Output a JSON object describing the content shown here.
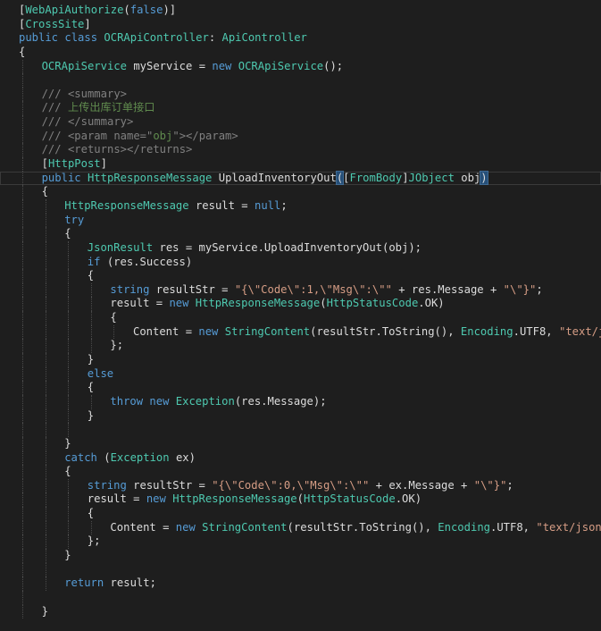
{
  "editor": {
    "lines": [
      {
        "indent": 0,
        "guides": [],
        "tokens": [
          [
            "bracket-attr",
            "["
          ],
          [
            "attr",
            "WebApiAuthorize"
          ],
          [
            "bracket-attr",
            "("
          ],
          [
            "kw",
            "false"
          ],
          [
            "bracket-attr",
            ")]"
          ]
        ]
      },
      {
        "indent": 0,
        "guides": [],
        "tokens": [
          [
            "bracket-attr",
            "["
          ],
          [
            "attr",
            "CrossSite"
          ],
          [
            "bracket-attr",
            "]"
          ]
        ]
      },
      {
        "indent": 0,
        "guides": [],
        "tokens": [
          [
            "kw",
            "public"
          ],
          [
            "ident",
            " "
          ],
          [
            "kw",
            "class"
          ],
          [
            "ident",
            " "
          ],
          [
            "type",
            "OCRApiController"
          ],
          [
            "ident",
            ": "
          ],
          [
            "type",
            "ApiController"
          ]
        ]
      },
      {
        "indent": 0,
        "guides": [],
        "tokens": [
          [
            "ident",
            "{"
          ]
        ]
      },
      {
        "indent": 1,
        "guides": [
          1
        ],
        "tokens": [
          [
            "type",
            "OCRApiService"
          ],
          [
            "ident",
            " myService = "
          ],
          [
            "kw",
            "new"
          ],
          [
            "ident",
            " "
          ],
          [
            "type",
            "OCRApiService"
          ],
          [
            "ident",
            "();"
          ]
        ]
      },
      {
        "indent": 0,
        "guides": [
          1
        ],
        "tokens": []
      },
      {
        "indent": 1,
        "guides": [
          1
        ],
        "tokens": [
          [
            "doctag",
            "///"
          ],
          [
            "doc",
            " "
          ],
          [
            "doctag",
            "<summary>"
          ]
        ]
      },
      {
        "indent": 1,
        "guides": [
          1
        ],
        "tokens": [
          [
            "doctag",
            "///"
          ],
          [
            "doc",
            " 上传出库订单接口"
          ]
        ]
      },
      {
        "indent": 1,
        "guides": [
          1
        ],
        "tokens": [
          [
            "doctag",
            "///"
          ],
          [
            "doc",
            " "
          ],
          [
            "doctag",
            "</summary>"
          ]
        ]
      },
      {
        "indent": 1,
        "guides": [
          1
        ],
        "tokens": [
          [
            "doctag",
            "///"
          ],
          [
            "doc",
            " "
          ],
          [
            "doctag",
            "<param name=\""
          ],
          [
            "doc",
            "obj"
          ],
          [
            "doctag",
            "\"></param>"
          ]
        ]
      },
      {
        "indent": 1,
        "guides": [
          1
        ],
        "tokens": [
          [
            "doctag",
            "///"
          ],
          [
            "doc",
            " "
          ],
          [
            "doctag",
            "<returns></returns>"
          ]
        ]
      },
      {
        "indent": 1,
        "guides": [
          1
        ],
        "tokens": [
          [
            "bracket-attr",
            "["
          ],
          [
            "attr",
            "HttpPost"
          ],
          [
            "bracket-attr",
            "]"
          ]
        ]
      },
      {
        "indent": 1,
        "guides": [
          1
        ],
        "current": true,
        "tokens": [
          [
            "kw",
            "public"
          ],
          [
            "ident",
            " "
          ],
          [
            "type",
            "HttpResponseMessage"
          ],
          [
            "ident",
            " "
          ],
          [
            "method",
            "UploadInventoryOut"
          ],
          [
            "paren",
            "("
          ],
          [
            "bracket-attr",
            "["
          ],
          [
            "attr",
            "FromBody"
          ],
          [
            "bracket-attr",
            "]"
          ],
          [
            "type",
            "JObject"
          ],
          [
            "ident",
            " obj"
          ],
          [
            "paren",
            ")"
          ]
        ]
      },
      {
        "indent": 1,
        "guides": [
          1
        ],
        "tokens": [
          [
            "ident",
            "{"
          ]
        ]
      },
      {
        "indent": 2,
        "guides": [
          1,
          2
        ],
        "tokens": [
          [
            "type",
            "HttpResponseMessage"
          ],
          [
            "ident",
            " result = "
          ],
          [
            "kw",
            "null"
          ],
          [
            "ident",
            ";"
          ]
        ]
      },
      {
        "indent": 2,
        "guides": [
          1,
          2
        ],
        "tokens": [
          [
            "kw",
            "try"
          ]
        ]
      },
      {
        "indent": 2,
        "guides": [
          1,
          2
        ],
        "tokens": [
          [
            "ident",
            "{"
          ]
        ]
      },
      {
        "indent": 3,
        "guides": [
          1,
          2,
          3
        ],
        "tokens": [
          [
            "type",
            "JsonResult"
          ],
          [
            "ident",
            " res = myService."
          ],
          [
            "method",
            "UploadInventoryOut"
          ],
          [
            "ident",
            "(obj);"
          ]
        ]
      },
      {
        "indent": 3,
        "guides": [
          1,
          2,
          3
        ],
        "tokens": [
          [
            "kw",
            "if"
          ],
          [
            "ident",
            " (res.Success)"
          ]
        ]
      },
      {
        "indent": 3,
        "guides": [
          1,
          2,
          3
        ],
        "tokens": [
          [
            "ident",
            "{"
          ]
        ]
      },
      {
        "indent": 4,
        "guides": [
          1,
          2,
          3,
          4
        ],
        "tokens": [
          [
            "kw",
            "string"
          ],
          [
            "ident",
            " resultStr = "
          ],
          [
            "str",
            "\"{\\\"Code\\\":1,\\\"Msg\\\":\\\"\""
          ],
          [
            "ident",
            " + res.Message + "
          ],
          [
            "str",
            "\"\\\"}\""
          ],
          [
            "ident",
            ";"
          ]
        ]
      },
      {
        "indent": 4,
        "guides": [
          1,
          2,
          3,
          4
        ],
        "tokens": [
          [
            "ident",
            "result = "
          ],
          [
            "kw",
            "new"
          ],
          [
            "ident",
            " "
          ],
          [
            "type",
            "HttpResponseMessage"
          ],
          [
            "ident",
            "("
          ],
          [
            "type",
            "HttpStatusCode"
          ],
          [
            "ident",
            ".OK)"
          ]
        ]
      },
      {
        "indent": 4,
        "guides": [
          1,
          2,
          3,
          4
        ],
        "tokens": [
          [
            "ident",
            "{"
          ]
        ]
      },
      {
        "indent": 5,
        "guides": [
          1,
          2,
          3,
          4,
          5
        ],
        "tokens": [
          [
            "ident",
            "Content = "
          ],
          [
            "kw",
            "new"
          ],
          [
            "ident",
            " "
          ],
          [
            "type",
            "StringContent"
          ],
          [
            "ident",
            "(resultStr."
          ],
          [
            "method",
            "ToString"
          ],
          [
            "ident",
            "(), "
          ],
          [
            "type",
            "Encoding"
          ],
          [
            "ident",
            ".UTF8, "
          ],
          [
            "str",
            "\"text/json\""
          ],
          [
            "ident",
            ")"
          ]
        ]
      },
      {
        "indent": 4,
        "guides": [
          1,
          2,
          3,
          4
        ],
        "tokens": [
          [
            "ident",
            "};"
          ]
        ]
      },
      {
        "indent": 3,
        "guides": [
          1,
          2,
          3
        ],
        "tokens": [
          [
            "ident",
            "}"
          ]
        ]
      },
      {
        "indent": 3,
        "guides": [
          1,
          2,
          3
        ],
        "tokens": [
          [
            "kw",
            "else"
          ]
        ]
      },
      {
        "indent": 3,
        "guides": [
          1,
          2,
          3
        ],
        "tokens": [
          [
            "ident",
            "{"
          ]
        ]
      },
      {
        "indent": 4,
        "guides": [
          1,
          2,
          3,
          4
        ],
        "tokens": [
          [
            "kw",
            "throw"
          ],
          [
            "ident",
            " "
          ],
          [
            "kw",
            "new"
          ],
          [
            "ident",
            " "
          ],
          [
            "type",
            "Exception"
          ],
          [
            "ident",
            "(res.Message);"
          ]
        ]
      },
      {
        "indent": 3,
        "guides": [
          1,
          2,
          3
        ],
        "tokens": [
          [
            "ident",
            "}"
          ]
        ]
      },
      {
        "indent": 0,
        "guides": [
          1,
          2,
          3
        ],
        "tokens": []
      },
      {
        "indent": 2,
        "guides": [
          1,
          2
        ],
        "tokens": [
          [
            "ident",
            "}"
          ]
        ]
      },
      {
        "indent": 2,
        "guides": [
          1,
          2
        ],
        "tokens": [
          [
            "kw",
            "catch"
          ],
          [
            "ident",
            " ("
          ],
          [
            "type",
            "Exception"
          ],
          [
            "ident",
            " ex)"
          ]
        ]
      },
      {
        "indent": 2,
        "guides": [
          1,
          2
        ],
        "tokens": [
          [
            "ident",
            "{"
          ]
        ]
      },
      {
        "indent": 3,
        "guides": [
          1,
          2,
          3
        ],
        "tokens": [
          [
            "kw",
            "string"
          ],
          [
            "ident",
            " resultStr = "
          ],
          [
            "str",
            "\"{\\\"Code\\\":0,\\\"Msg\\\":\\\"\""
          ],
          [
            "ident",
            " + ex.Message + "
          ],
          [
            "str",
            "\"\\\"}\""
          ],
          [
            "ident",
            ";"
          ]
        ]
      },
      {
        "indent": 3,
        "guides": [
          1,
          2,
          3
        ],
        "tokens": [
          [
            "ident",
            "result = "
          ],
          [
            "kw",
            "new"
          ],
          [
            "ident",
            " "
          ],
          [
            "type",
            "HttpResponseMessage"
          ],
          [
            "ident",
            "("
          ],
          [
            "type",
            "HttpStatusCode"
          ],
          [
            "ident",
            ".OK)"
          ]
        ]
      },
      {
        "indent": 3,
        "guides": [
          1,
          2,
          3
        ],
        "tokens": [
          [
            "ident",
            "{"
          ]
        ]
      },
      {
        "indent": 4,
        "guides": [
          1,
          2,
          3,
          4
        ],
        "tokens": [
          [
            "ident",
            "Content = "
          ],
          [
            "kw",
            "new"
          ],
          [
            "ident",
            " "
          ],
          [
            "type",
            "StringContent"
          ],
          [
            "ident",
            "(resultStr."
          ],
          [
            "method",
            "ToString"
          ],
          [
            "ident",
            "(), "
          ],
          [
            "type",
            "Encoding"
          ],
          [
            "ident",
            ".UTF8, "
          ],
          [
            "str",
            "\"text/json\""
          ],
          [
            "ident",
            ")"
          ]
        ]
      },
      {
        "indent": 3,
        "guides": [
          1,
          2,
          3
        ],
        "tokens": [
          [
            "ident",
            "};"
          ]
        ]
      },
      {
        "indent": 2,
        "guides": [
          1,
          2
        ],
        "tokens": [
          [
            "ident",
            "}"
          ]
        ]
      },
      {
        "indent": 0,
        "guides": [
          1,
          2
        ],
        "tokens": []
      },
      {
        "indent": 2,
        "guides": [
          1,
          2
        ],
        "tokens": [
          [
            "kw",
            "return"
          ],
          [
            "ident",
            " result;"
          ]
        ]
      },
      {
        "indent": 0,
        "guides": [
          1
        ],
        "tokens": []
      },
      {
        "indent": 1,
        "guides": [
          1
        ],
        "tokens": [
          [
            "ident",
            "}"
          ]
        ]
      }
    ]
  }
}
